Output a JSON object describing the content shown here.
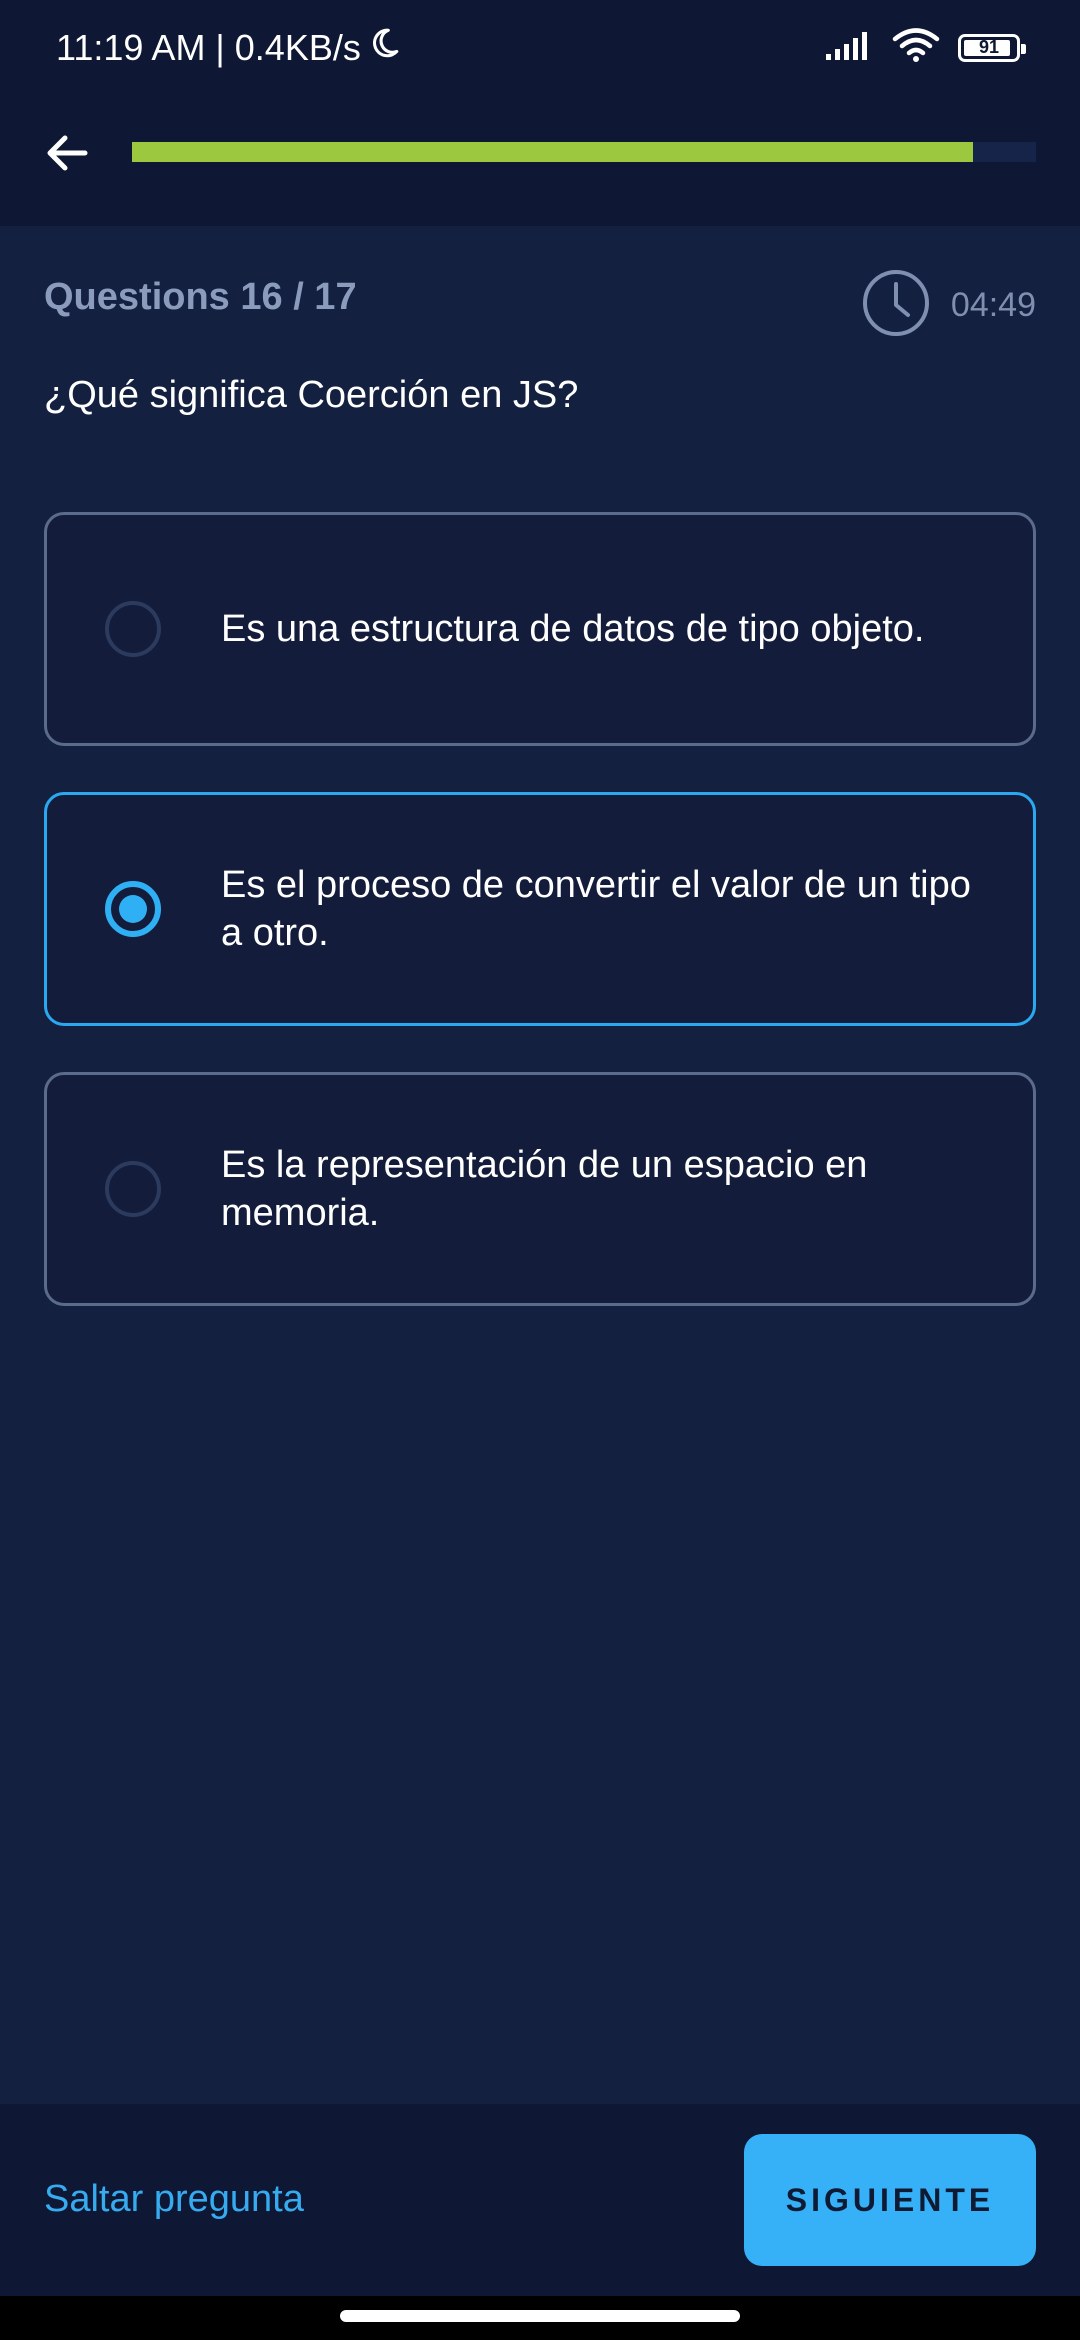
{
  "status_bar": {
    "time_speed": "11:19 AM | 0.4KB/s",
    "moon_icon": "moon-icon",
    "signal_icon": "signal-icon",
    "wifi_icon": "wifi-icon",
    "battery_level": "91"
  },
  "header": {
    "back_icon": "arrow-left-icon",
    "progress_fraction": 0.93,
    "progress_color": "#9cc83f"
  },
  "quiz": {
    "counter": "Questions 16 / 17",
    "timer_icon": "clock-icon",
    "timer": "04:49",
    "question": "¿Qué significa Coerción en JS?",
    "options": [
      {
        "label": "Es una estructura de datos de tipo objeto.",
        "selected": false
      },
      {
        "label": "Es el proceso de convertir el valor de un tipo a otro.",
        "selected": true
      },
      {
        "label": "Es la representación de un espacio en memoria.",
        "selected": false
      }
    ]
  },
  "footer": {
    "skip_label": "Saltar pregunta",
    "next_label": "SIGUIENTE"
  },
  "colors": {
    "background": "#142040",
    "bar_background": "#0e1733",
    "accent": "#36b1f8",
    "selected_border": "#2aa9f0"
  }
}
